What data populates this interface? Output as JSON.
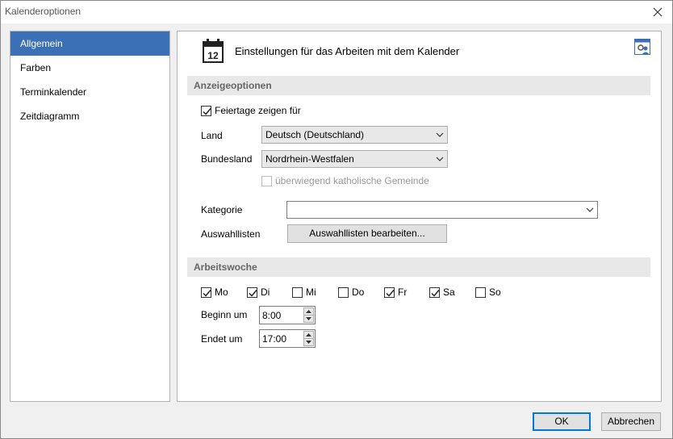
{
  "window": {
    "title": "Kalenderoptionen"
  },
  "sidebar": {
    "items": [
      {
        "label": "Allgemein",
        "active": true
      },
      {
        "label": "Farben",
        "active": false
      },
      {
        "label": "Terminkalender",
        "active": false
      },
      {
        "label": "Zeitdiagramm",
        "active": false
      }
    ]
  },
  "header": {
    "title": "Einstellungen für das Arbeiten mit dem Kalender",
    "calendar_number": "12"
  },
  "anzeige": {
    "section_label": "Anzeigeoptionen",
    "holidays_label": "Feiertage zeigen für",
    "holidays_checked": true,
    "land_label": "Land",
    "land_value": "Deutsch (Deutschland)",
    "bundesland_label": "Bundesland",
    "bundesland_value": "Nordrhein-Westfalen",
    "catholic_label": "überwiegend katholische Gemeinde",
    "catholic_checked": false,
    "kategorie_label": "Kategorie",
    "kategorie_value": "",
    "auswahllisten_label": "Auswahllisten",
    "auswahllisten_button": "Auswahllisten bearbeiten..."
  },
  "arbeitswoche": {
    "section_label": "Arbeitswoche",
    "days": [
      {
        "label": "Mo",
        "checked": true
      },
      {
        "label": "Di",
        "checked": true
      },
      {
        "label": "Mi",
        "checked": false
      },
      {
        "label": "Do",
        "checked": false
      },
      {
        "label": "Fr",
        "checked": true
      },
      {
        "label": "Sa",
        "checked": true
      },
      {
        "label": "So",
        "checked": false
      }
    ],
    "begin_label": "Beginn um",
    "begin_value": "8:00",
    "end_label": "Endet um",
    "end_value": "17:00"
  },
  "footer": {
    "ok": "OK",
    "cancel": "Abbrechen"
  },
  "colors": {
    "accent": "#3b6fb6",
    "default_button_border": "#0078d7"
  }
}
